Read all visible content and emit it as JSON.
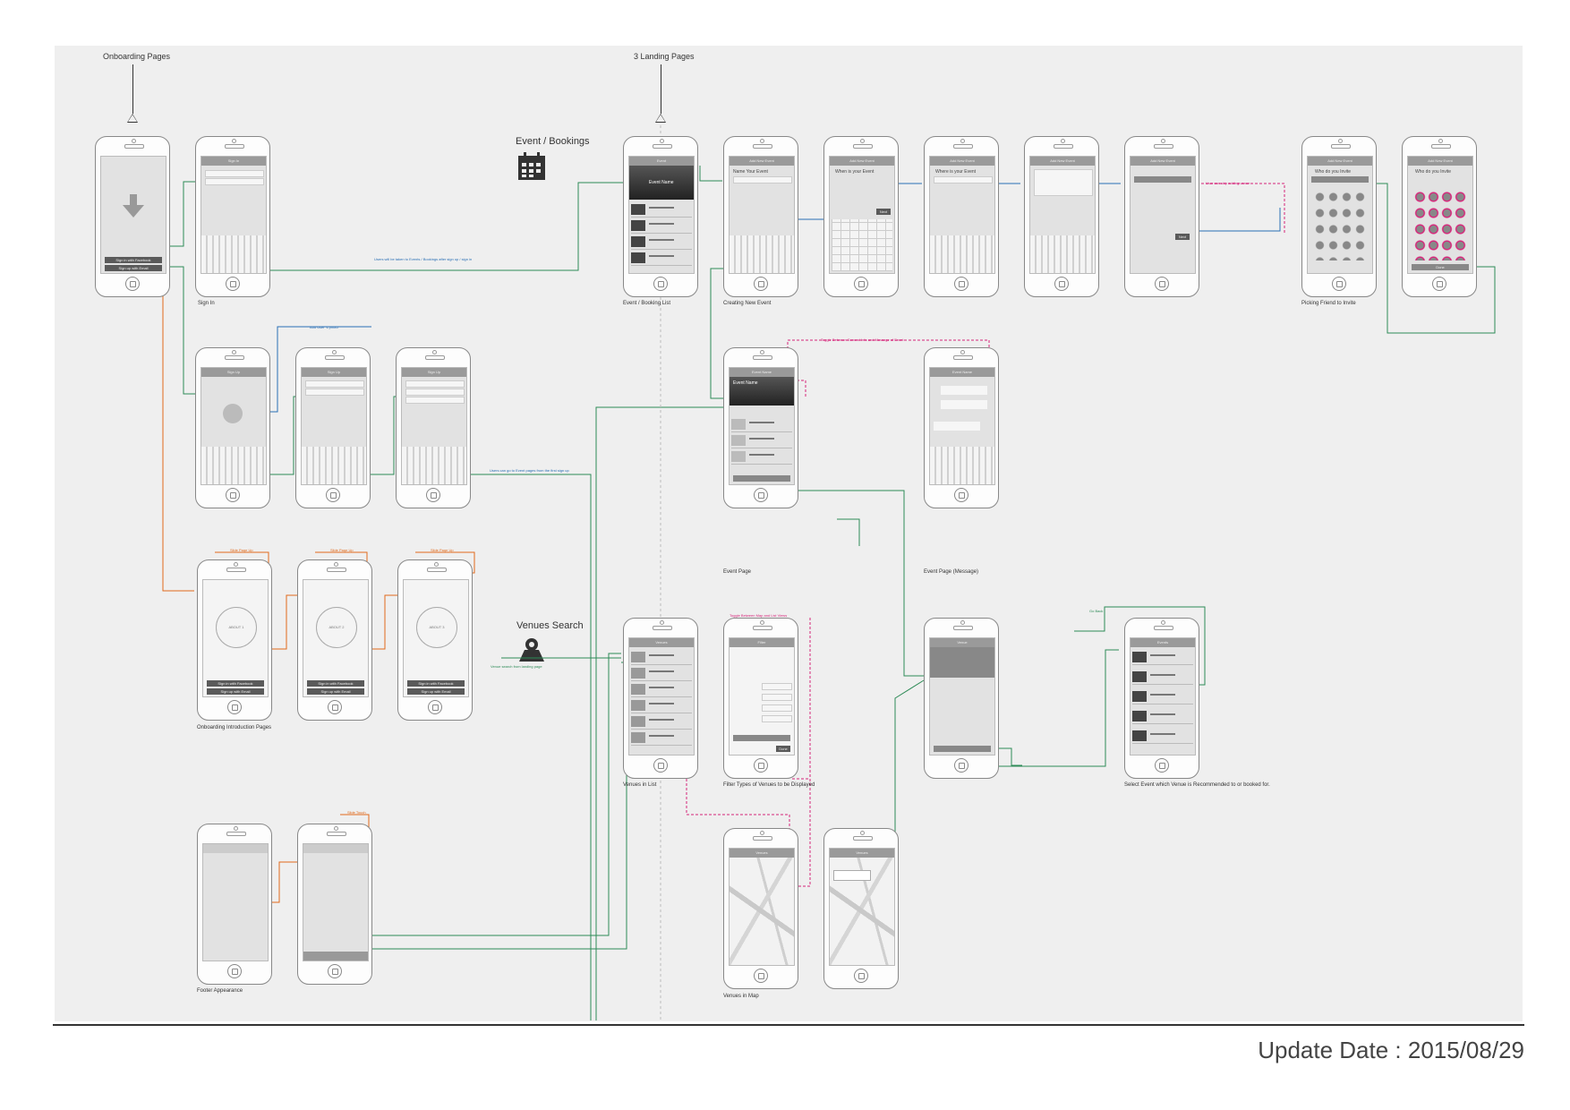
{
  "sections": {
    "onboarding": "Onboarding Pages",
    "landing": "3 Landing Pages",
    "events": "Event / Bookings",
    "venues": "Venues Search"
  },
  "captions": {
    "sign_in": "Sign In",
    "event_booking_list": "Event / Booking List",
    "creating_new_event": "Creating New Event",
    "picking_friend": "Picking Friend to Invite",
    "event_page": "Event Page",
    "event_page_message": "Event Page (Message)",
    "onboarding_intro": "Onboarding Introduction Pages",
    "venues_in_list": "Venues in List",
    "filter_types": "Filter Types of Venues to be Displayed",
    "select_event": "Select Event which Venue is Recommended to or booked for.",
    "footer_appearance": "Footer Appearance",
    "venues_in_map": "Venues in Map"
  },
  "screen_text": {
    "sign_in_facebook": "Sign in with Facebook",
    "sign_up_email": "Sign up with Email",
    "about_1": "ABOUT 1",
    "about_2": "ABOUT 2",
    "about_3": "ABOUT 3",
    "event_name": "Event Name",
    "name_your_event": "Name Your Event",
    "when_is_your_event": "When is your Event",
    "where_is_your_event": "Where is your Event",
    "next": "Next",
    "who_do_you_invite": "Who do you Invite",
    "done": "Done"
  },
  "annotations": {
    "slide_page_up": "Slide Page Up",
    "slide_touch": "Slide Touch",
    "toggle_general_message": "Toggle Between General Info and Message of Event",
    "toggle_map_list": "Toggle Between Map and List Views",
    "go_back": "Go Back"
  },
  "update_date": "Update Date : 2015/08/29",
  "colors": {
    "green": "#2e8b57",
    "blue": "#2a6fb5",
    "orange": "#e06a1b",
    "pink": "#d6257a",
    "board": "#efefef"
  }
}
